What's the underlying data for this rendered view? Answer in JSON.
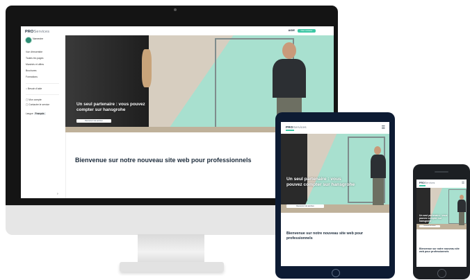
{
  "brand": {
    "name": "PRO",
    "suffix": "Services"
  },
  "colors": {
    "accent": "#3cc7a4",
    "navy": "#1b2a3a",
    "mint": "#a8e0cf",
    "device_dark": "#141414"
  },
  "desktop": {
    "sidebar": {
      "user_name": "Namestre",
      "items": [
        "Vue d'ensemble",
        "Toutes les pages",
        "Marchés et offres",
        "Brochures",
        "Formations"
      ],
      "help": "Besoin d'aide",
      "links": [
        "Mon compte",
        "Contacter le service"
      ],
      "lang_label": "Langue",
      "lang_value": "Français"
    },
    "topbar": {
      "link": "AIDE",
      "button": "Nous contacter"
    },
    "hero": {
      "title": "Un seul partenaire : vous pouvez compter sur hansgrohe",
      "button": "Découvrez nos services"
    },
    "headline": "Bienvenue sur notre nouveau site web pour professionnels"
  },
  "tablet": {
    "menu_icon": "hamburger-icon",
    "hero": {
      "title": "Un seul partenaire : vous pouvez compter sur hansgrohe",
      "button": "Découvrez nos services"
    },
    "headline": "Bienvenue sur notre nouveau site web pour professionnels"
  },
  "phone": {
    "menu_icon": "hamburger-icon",
    "hero": {
      "title": "Un seul partenaire : vous pouvez compter sur hansgrohe",
      "button": "Découvrez nos services"
    },
    "headline": "Bienvenue sur notre nouveau site web pour professionnels"
  }
}
